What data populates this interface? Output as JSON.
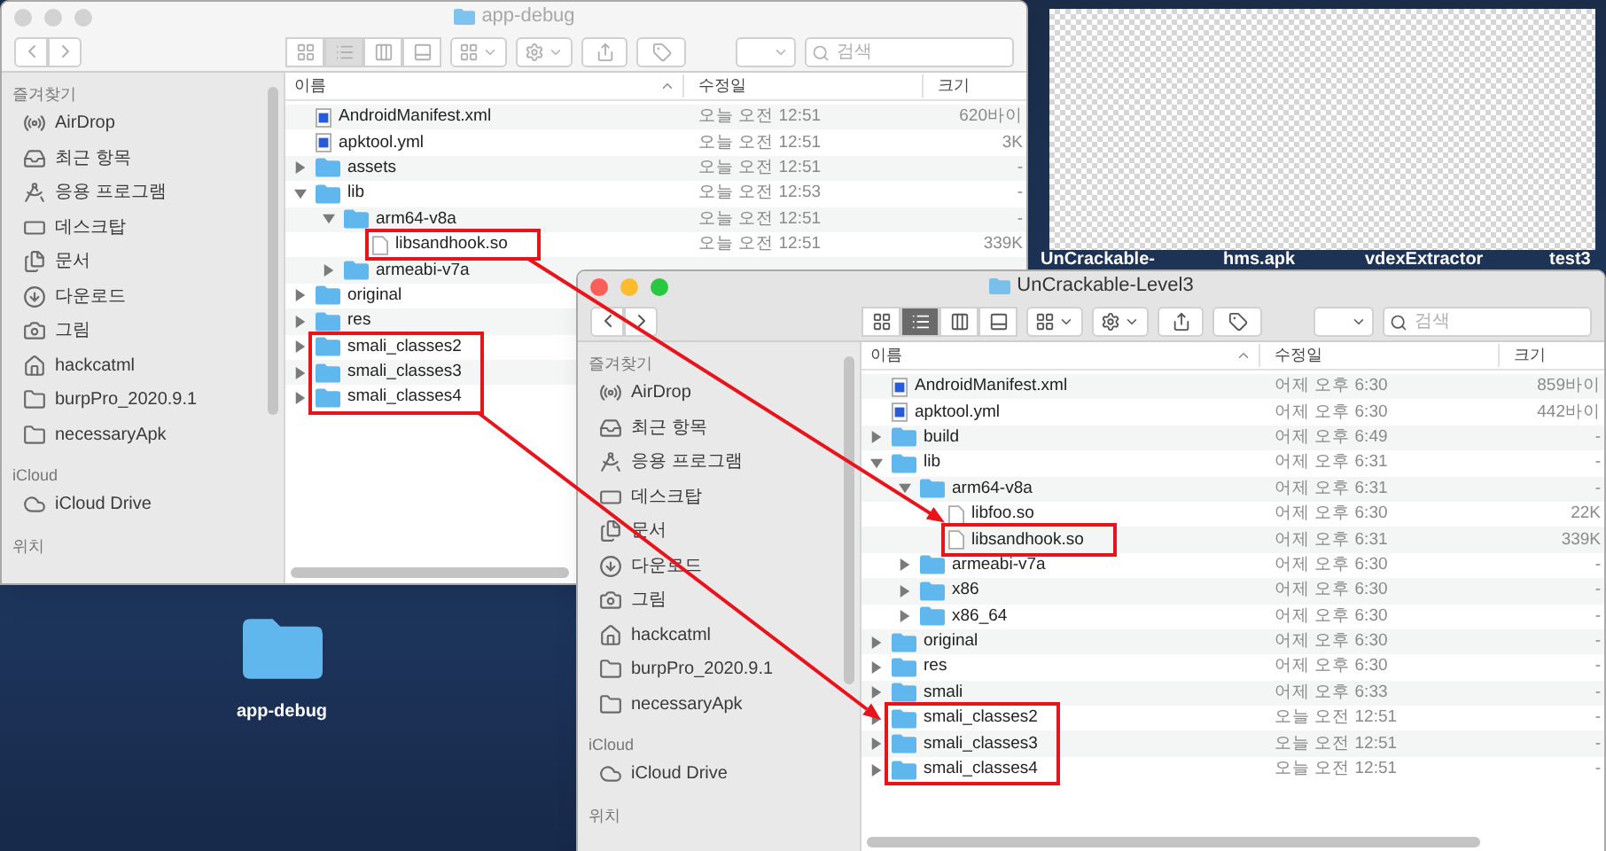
{
  "desktop": {
    "top_labels": [
      "UnCrackable-",
      "hms.apk",
      "vdexExtractor",
      "test3"
    ],
    "icons": [
      {
        "label": "app-debug"
      }
    ]
  },
  "windows": [
    {
      "title": "app-debug",
      "active": false,
      "view_modes": [
        {
          "kind": "icons",
          "selected": false
        },
        {
          "kind": "list",
          "selected": true
        },
        {
          "kind": "columns",
          "selected": false
        },
        {
          "kind": "gallery",
          "selected": false
        }
      ],
      "search": {
        "placeholder": "검색"
      },
      "sidebar": [
        {
          "heading": "즐겨찾기",
          "items": [
            {
              "label": "AirDrop",
              "kind": "airdrop"
            },
            {
              "label": "최근 항목",
              "kind": "recent"
            },
            {
              "label": "응용 프로그램",
              "kind": "apps"
            },
            {
              "label": "데스크탑",
              "kind": "desktop"
            },
            {
              "label": "문서",
              "kind": "documents"
            },
            {
              "label": "다운로드",
              "kind": "downloads"
            },
            {
              "label": "그림",
              "kind": "pictures"
            },
            {
              "label": "hackcatml",
              "kind": "home"
            },
            {
              "label": "burpPro_2020.9.1",
              "kind": "folder"
            },
            {
              "label": "necessaryApk",
              "kind": "folder"
            }
          ]
        },
        {
          "heading": "iCloud",
          "items": [
            {
              "label": "iCloud Drive",
              "kind": "cloud"
            }
          ]
        },
        {
          "heading": "위치"
        }
      ],
      "columns": [
        "이름",
        "수정일",
        "크기"
      ],
      "rows": [
        {
          "name": "AndroidManifest.xml",
          "kind": "doc",
          "modified": "오늘 오전 12:51",
          "size": "620바이",
          "highlighted": false
        },
        {
          "name": "apktool.yml",
          "kind": "doc",
          "modified": "오늘 오전 12:51",
          "size": "3K",
          "highlighted": false
        },
        {
          "name": "assets",
          "kind": "folder",
          "expanded": false,
          "modified": "오늘 오전 12:51",
          "size": "-",
          "highlighted": false
        },
        {
          "name": "lib",
          "kind": "folder",
          "expanded": true,
          "modified": "오늘 오전 12:53",
          "size": "-",
          "highlighted": false,
          "children": [
            {
              "name": "arm64-v8a",
              "kind": "folder",
              "expanded": true,
              "modified": "오늘 오전 12:51",
              "size": "-",
              "highlighted": false,
              "children": [
                {
                  "name": "libsandhook.so",
                  "kind": "file",
                  "modified": "오늘 오전 12:51",
                  "size": "339K",
                  "highlighted": true
                }
              ]
            },
            {
              "name": "armeabi-v7a",
              "kind": "folder",
              "expanded": false,
              "highlighted": false
            }
          ]
        },
        {
          "name": "original",
          "kind": "folder",
          "expanded": false,
          "highlighted": false
        },
        {
          "name": "res",
          "kind": "folder",
          "expanded": false,
          "highlighted": false
        },
        {
          "name": "smali_classes2",
          "kind": "folder",
          "expanded": false,
          "highlighted": true
        },
        {
          "name": "smali_classes3",
          "kind": "folder",
          "expanded": false,
          "highlighted": true
        },
        {
          "name": "smali_classes4",
          "kind": "folder",
          "expanded": false,
          "highlighted": true
        }
      ]
    },
    {
      "title": "UnCrackable-Level3",
      "active": true,
      "view_modes": [
        {
          "kind": "icons",
          "selected": false
        },
        {
          "kind": "list",
          "selected": true
        },
        {
          "kind": "columns",
          "selected": false
        },
        {
          "kind": "gallery",
          "selected": false
        }
      ],
      "search": {
        "placeholder": "검색"
      },
      "sidebar": [
        {
          "heading": "즐겨찾기",
          "items": [
            {
              "label": "AirDrop",
              "kind": "airdrop"
            },
            {
              "label": "최근 항목",
              "kind": "recent"
            },
            {
              "label": "응용 프로그램",
              "kind": "apps"
            },
            {
              "label": "데스크탑",
              "kind": "desktop"
            },
            {
              "label": "문서",
              "kind": "documents"
            },
            {
              "label": "다운로드",
              "kind": "downloads"
            },
            {
              "label": "그림",
              "kind": "pictures"
            },
            {
              "label": "hackcatml",
              "kind": "home"
            },
            {
              "label": "burpPro_2020.9.1",
              "kind": "folder"
            },
            {
              "label": "necessaryApk",
              "kind": "folder"
            }
          ]
        },
        {
          "heading": "iCloud",
          "items": [
            {
              "label": "iCloud Drive",
              "kind": "cloud"
            }
          ]
        },
        {
          "heading": "위치"
        }
      ],
      "columns": [
        "이름",
        "수정일",
        "크기"
      ],
      "rows": [
        {
          "name": "AndroidManifest.xml",
          "kind": "doc",
          "modified": "어제 오후 6:30",
          "size": "859바이",
          "highlighted": false
        },
        {
          "name": "apktool.yml",
          "kind": "doc",
          "modified": "어제 오후 6:30",
          "size": "442바이",
          "highlighted": false
        },
        {
          "name": "build",
          "kind": "folder",
          "expanded": false,
          "modified": "어제 오후 6:49",
          "size": "-",
          "highlighted": false
        },
        {
          "name": "lib",
          "kind": "folder",
          "expanded": true,
          "modified": "어제 오후 6:31",
          "size": "-",
          "highlighted": false,
          "children": [
            {
              "name": "arm64-v8a",
              "kind": "folder",
              "expanded": true,
              "modified": "어제 오후 6:31",
              "size": "-",
              "highlighted": false,
              "children": [
                {
                  "name": "libfoo.so",
                  "kind": "file",
                  "modified": "어제 오후 6:30",
                  "size": "22K",
                  "highlighted": false
                },
                {
                  "name": "libsandhook.so",
                  "kind": "file",
                  "modified": "어제 오후 6:31",
                  "size": "339K",
                  "highlighted": true
                }
              ]
            },
            {
              "name": "armeabi-v7a",
              "kind": "folder",
              "expanded": false,
              "modified": "어제 오후 6:30",
              "size": "-",
              "highlighted": false
            },
            {
              "name": "x86",
              "kind": "folder",
              "expanded": false,
              "modified": "어제 오후 6:30",
              "size": "-",
              "highlighted": false
            },
            {
              "name": "x86_64",
              "kind": "folder",
              "expanded": false,
              "modified": "어제 오후 6:30",
              "size": "-",
              "highlighted": false
            }
          ]
        },
        {
          "name": "original",
          "kind": "folder",
          "expanded": false,
          "modified": "어제 오후 6:30",
          "size": "-",
          "highlighted": false
        },
        {
          "name": "res",
          "kind": "folder",
          "expanded": false,
          "modified": "어제 오후 6:30",
          "size": "-",
          "highlighted": false
        },
        {
          "name": "smali",
          "kind": "folder",
          "expanded": false,
          "modified": "어제 오후 6:33",
          "size": "-",
          "highlighted": false
        },
        {
          "name": "smali_classes2",
          "kind": "folder",
          "expanded": false,
          "modified": "오늘 오전 12:51",
          "size": "-",
          "highlighted": true
        },
        {
          "name": "smali_classes3",
          "kind": "folder",
          "expanded": false,
          "modified": "오늘 오전 12:51",
          "size": "-",
          "highlighted": true
        },
        {
          "name": "smali_classes4",
          "kind": "folder",
          "expanded": false,
          "modified": "오늘 오전 12:51",
          "size": "-",
          "highlighted": true
        }
      ]
    }
  ]
}
